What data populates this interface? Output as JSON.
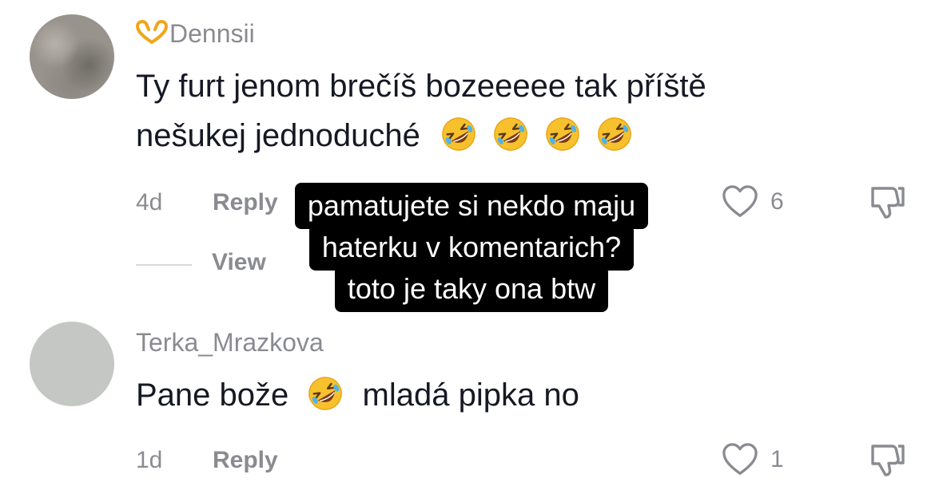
{
  "comments": [
    {
      "username": "Dennsii",
      "username_icon": "heart-hands-icon",
      "text_line1": "Ty furt jenom brečíš bozeeeee tak příště",
      "text_line2": "nešukej jednoduché",
      "emoji": "rolling-on-floor-laughing-icon",
      "emoji_count": 4,
      "time": "4d",
      "reply_label": "Reply",
      "likes": "6",
      "view_replies_label": "View"
    },
    {
      "username": "Terka_Mrazkova",
      "text_before_emoji": "Pane bože",
      "text_after_emoji": "mladá pipka no",
      "emoji": "rolling-on-floor-laughing-icon",
      "time": "1d",
      "reply_label": "Reply",
      "likes": "1"
    }
  ],
  "caption": {
    "line1": "pamatujete si nekdo maju",
    "line2": "haterku v komentarich?",
    "line3": "toto je taky ona btw"
  },
  "colors": {
    "text": "#161823",
    "muted": "#8a8b91",
    "caption_bg": "#000000",
    "caption_text": "#ffffff"
  }
}
